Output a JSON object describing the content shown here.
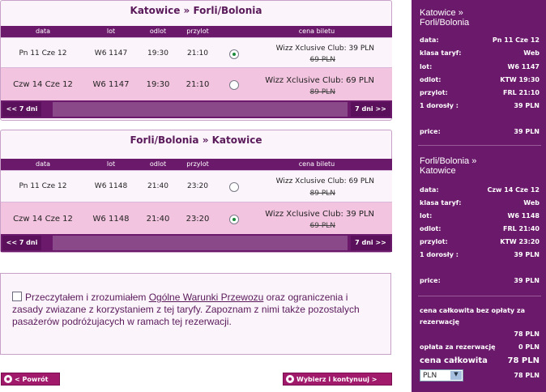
{
  "headers": {
    "date": "data",
    "flight": "lot",
    "departure": "odlot",
    "arrival": "przylot",
    "price": "cena biletu"
  },
  "nav": {
    "prev": "<< 7 dni",
    "next": "7 dni >>"
  },
  "outbound": {
    "title": "Katowice » Forli/Bolonia",
    "rows": [
      {
        "date": "Pn 11 Cze 12",
        "flight": "W6 1147",
        "departure": "19:30",
        "arrival": "21:10",
        "price": "Wizz Xclusive Club: 39 PLN",
        "old_price": "69 PLN",
        "selected": true
      },
      {
        "date": "Czw 14 Cze 12",
        "flight": "W6 1147",
        "departure": "19:30",
        "arrival": "21:10",
        "price": "Wizz Xclusive Club: 69 PLN",
        "old_price": "89 PLN",
        "selected": false
      }
    ]
  },
  "return": {
    "title": "Forli/Bolonia » Katowice",
    "rows": [
      {
        "date": "Pn 11 Cze 12",
        "flight": "W6 1148",
        "departure": "21:40",
        "arrival": "23:20",
        "price": "Wizz Xclusive Club: 69 PLN",
        "old_price": "89 PLN",
        "selected": false
      },
      {
        "date": "Czw 14 Cze 12",
        "flight": "W6 1148",
        "departure": "21:40",
        "arrival": "23:20",
        "price": "Wizz Xclusive Club: 39 PLN",
        "old_price": "69 PLN",
        "selected": true
      }
    ]
  },
  "terms": {
    "before": "Przeczytałem i zrozumiałem ",
    "link": "Ogólne Warunki Przewozu",
    "after": " oraz ograniczenia i zasady zwiazane z korzystaniem z tej taryfy. Zapoznam z nimi także pozostalych pasażerów podróżujacych w ramach tej rezerwacji."
  },
  "buttons": {
    "back": "< Powrót",
    "continue": "Wybierz i kontynuuj >"
  },
  "summary": {
    "outbound": {
      "title_line1": "Katowice »",
      "title_line2": "Forli/Bolonia",
      "lines": [
        {
          "label": "data:",
          "value": "Pn 11 Cze 12"
        },
        {
          "label": "klasa taryf:",
          "value": "Web"
        },
        {
          "label": "lot:",
          "value": "W6 1147"
        },
        {
          "label": "odlot:",
          "value": "KTW 19:30"
        },
        {
          "label": "przylot:",
          "value": "FRL 21:10"
        },
        {
          "label": "1 dorosły :",
          "value": "39 PLN"
        }
      ],
      "price_label": "price:",
      "price_value": "39 PLN"
    },
    "return": {
      "title_line1": "Forli/Bolonia »",
      "title_line2": "Katowice",
      "lines": [
        {
          "label": "data:",
          "value": "Czw 14 Cze 12"
        },
        {
          "label": "klasa taryf:",
          "value": "Web"
        },
        {
          "label": "lot:",
          "value": "W6 1148"
        },
        {
          "label": "odlot:",
          "value": "FRL 21:40"
        },
        {
          "label": "przylot:",
          "value": "KTW 23:20"
        },
        {
          "label": "1 dorosły :",
          "value": "39 PLN"
        }
      ],
      "price_label": "price:",
      "price_value": "39 PLN"
    },
    "total_no_fee_label1": "cena całkowita bez opłaty za",
    "total_no_fee_label2": "rezerwację",
    "total_no_fee_value": "78 PLN",
    "fee_label": "opłata za rezerwację",
    "fee_value": "0 PLN",
    "total_label": "cena całkowita",
    "total_value": "78 PLN",
    "currency": "PLN",
    "currency_total": "78 PLN"
  }
}
